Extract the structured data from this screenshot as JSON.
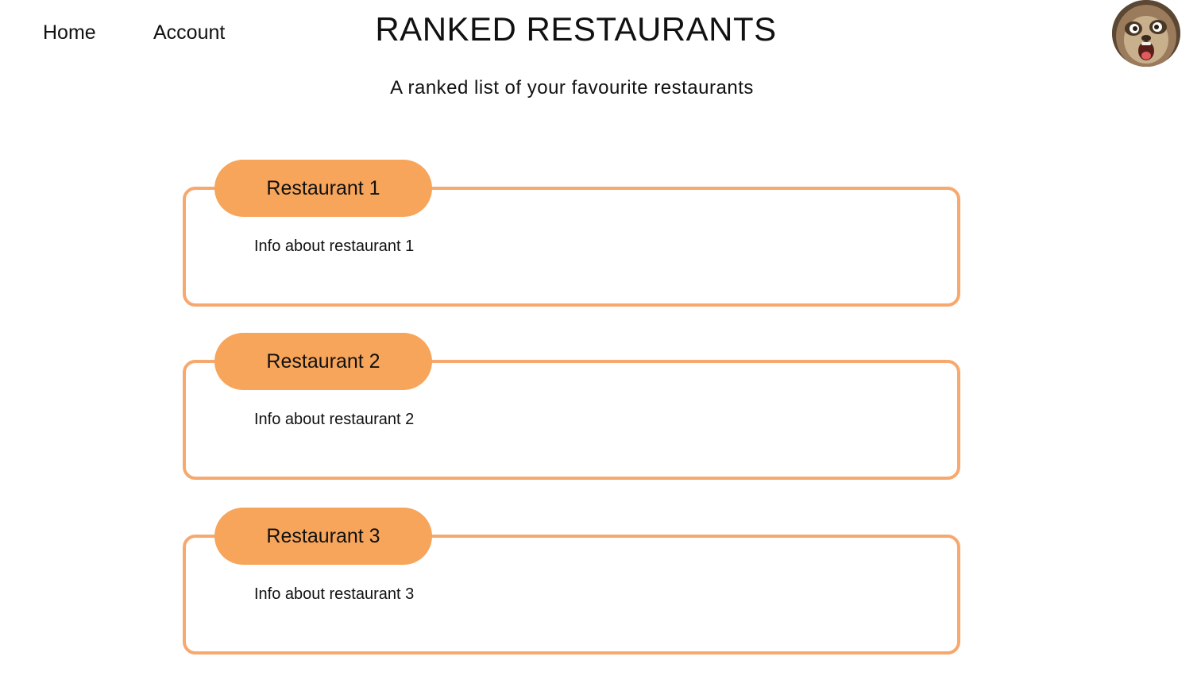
{
  "nav": {
    "home_label": "Home",
    "account_label": "Account"
  },
  "header": {
    "title": "RANKED RESTAURANTS",
    "subtitle": "A ranked list of your favourite restaurants"
  },
  "avatar": {
    "icon": "sloth-avatar-icon"
  },
  "restaurants": [
    {
      "name": "Restaurant 1",
      "info": "Info about restaurant 1"
    },
    {
      "name": "Restaurant 2",
      "info": "Info about restaurant 2"
    },
    {
      "name": "Restaurant 3",
      "info": "Info about restaurant 3"
    }
  ],
  "colors": {
    "accent": "#f7a55b",
    "card_border": "#f6a86f"
  }
}
